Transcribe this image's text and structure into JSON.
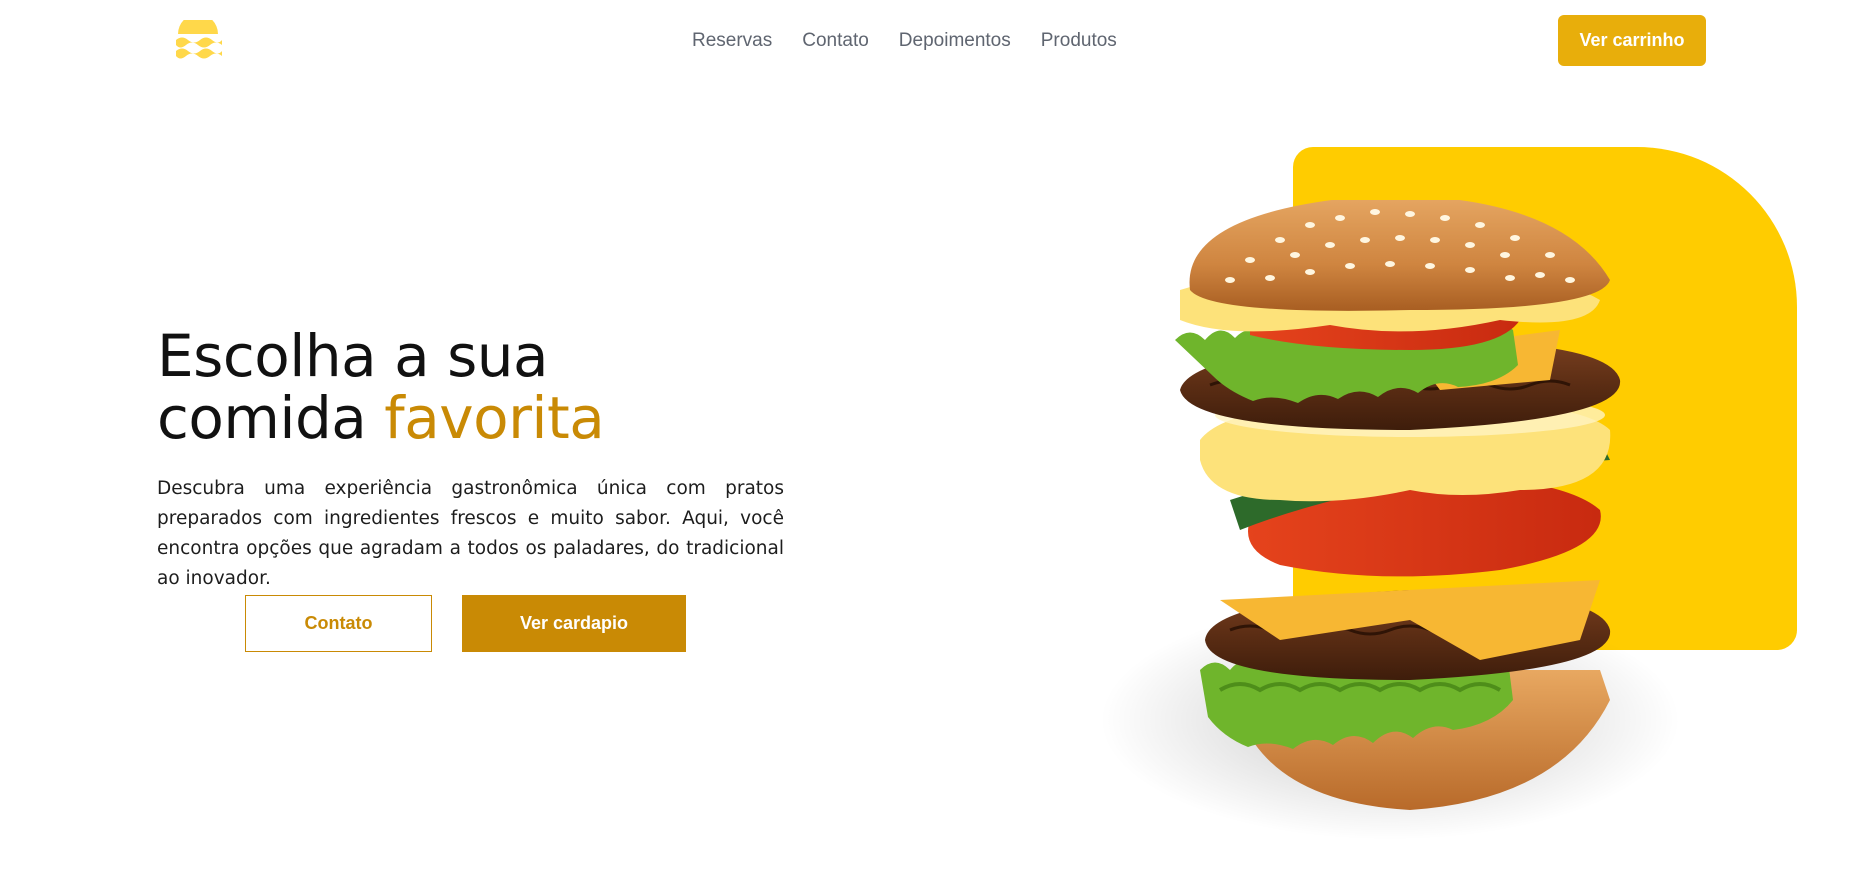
{
  "brand": {
    "logo_icon": "wave-sun-icon",
    "color": "#ffd84a"
  },
  "nav": {
    "items": [
      {
        "label": "Reservas"
      },
      {
        "label": "Contato"
      },
      {
        "label": "Depoimentos"
      },
      {
        "label": "Produtos"
      }
    ]
  },
  "header": {
    "cart_label": "Ver carrinho"
  },
  "hero": {
    "title_line1": "Escolha a sua",
    "title_line2_prefix": "comida ",
    "title_line2_accent": "favorita",
    "description": "Descubra uma experiência gastronômica única com pratos preparados com ingredientes frescos e muito sabor. Aqui, você encontra opções que agradam a todos os paladares, do tradicional ao inovador.",
    "contact_button": "Contato",
    "menu_button": "Ver cardapio",
    "image_icon": "burger-image"
  },
  "colors": {
    "accent": "#c98a05",
    "cart_button": "#e8ae0b",
    "hero_block": "#ffcc00"
  }
}
